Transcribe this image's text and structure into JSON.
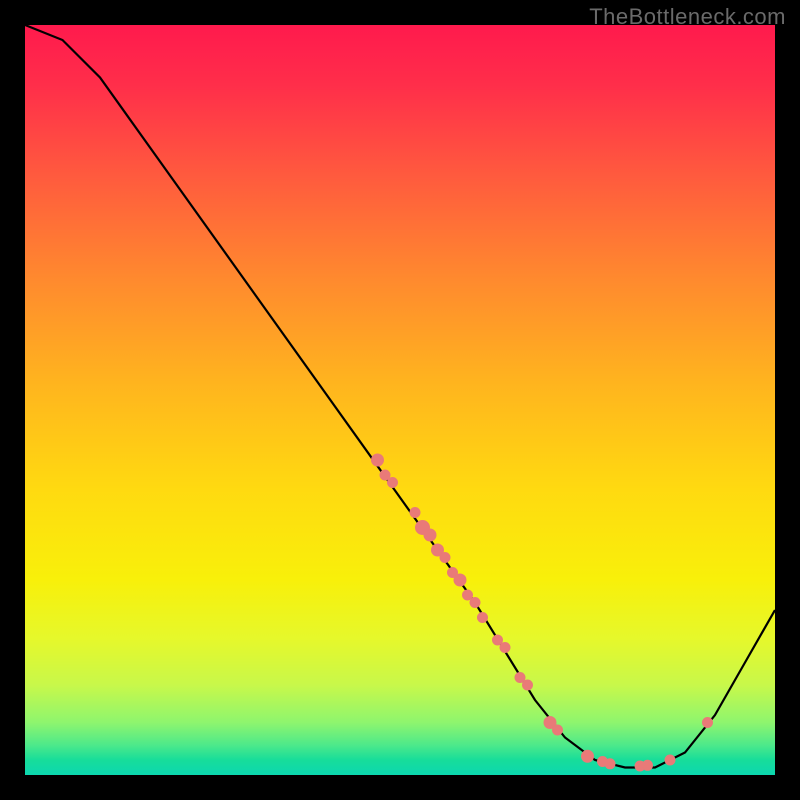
{
  "watermark": "TheBottleneck.com",
  "chart_data": {
    "type": "line",
    "title": "",
    "xlabel": "",
    "ylabel": "",
    "xlim": [
      0,
      100
    ],
    "ylim": [
      0,
      100
    ],
    "grid": false,
    "legend": false,
    "curve": [
      {
        "x": 0,
        "y": 100
      },
      {
        "x": 5,
        "y": 98
      },
      {
        "x": 10,
        "y": 93
      },
      {
        "x": 20,
        "y": 79
      },
      {
        "x": 30,
        "y": 65
      },
      {
        "x": 40,
        "y": 51
      },
      {
        "x": 50,
        "y": 37
      },
      {
        "x": 60,
        "y": 23
      },
      {
        "x": 68,
        "y": 10
      },
      {
        "x": 72,
        "y": 5
      },
      {
        "x": 76,
        "y": 2
      },
      {
        "x": 80,
        "y": 1
      },
      {
        "x": 84,
        "y": 1
      },
      {
        "x": 88,
        "y": 3
      },
      {
        "x": 92,
        "y": 8
      },
      {
        "x": 96,
        "y": 15
      },
      {
        "x": 100,
        "y": 22
      }
    ],
    "points": [
      {
        "x": 47,
        "y": 42,
        "r": 6
      },
      {
        "x": 48,
        "y": 40,
        "r": 5
      },
      {
        "x": 49,
        "y": 39,
        "r": 5
      },
      {
        "x": 52,
        "y": 35,
        "r": 5
      },
      {
        "x": 53,
        "y": 33,
        "r": 7
      },
      {
        "x": 54,
        "y": 32,
        "r": 6
      },
      {
        "x": 55,
        "y": 30,
        "r": 6
      },
      {
        "x": 56,
        "y": 29,
        "r": 5
      },
      {
        "x": 57,
        "y": 27,
        "r": 5
      },
      {
        "x": 58,
        "y": 26,
        "r": 6
      },
      {
        "x": 59,
        "y": 24,
        "r": 5
      },
      {
        "x": 60,
        "y": 23,
        "r": 5
      },
      {
        "x": 61,
        "y": 21,
        "r": 5
      },
      {
        "x": 63,
        "y": 18,
        "r": 5
      },
      {
        "x": 64,
        "y": 17,
        "r": 5
      },
      {
        "x": 66,
        "y": 13,
        "r": 5
      },
      {
        "x": 67,
        "y": 12,
        "r": 5
      },
      {
        "x": 70,
        "y": 7,
        "r": 6
      },
      {
        "x": 71,
        "y": 6,
        "r": 5
      },
      {
        "x": 75,
        "y": 2.5,
        "r": 6
      },
      {
        "x": 77,
        "y": 1.8,
        "r": 5
      },
      {
        "x": 78,
        "y": 1.5,
        "r": 5
      },
      {
        "x": 82,
        "y": 1.2,
        "r": 5
      },
      {
        "x": 83,
        "y": 1.3,
        "r": 5
      },
      {
        "x": 86,
        "y": 2,
        "r": 5
      },
      {
        "x": 91,
        "y": 7,
        "r": 5
      }
    ],
    "colors": {
      "curve": "#000000",
      "points": "#e97a78",
      "gradient_top": "#ff1a4d",
      "gradient_bottom": "#0cd7b0"
    }
  }
}
